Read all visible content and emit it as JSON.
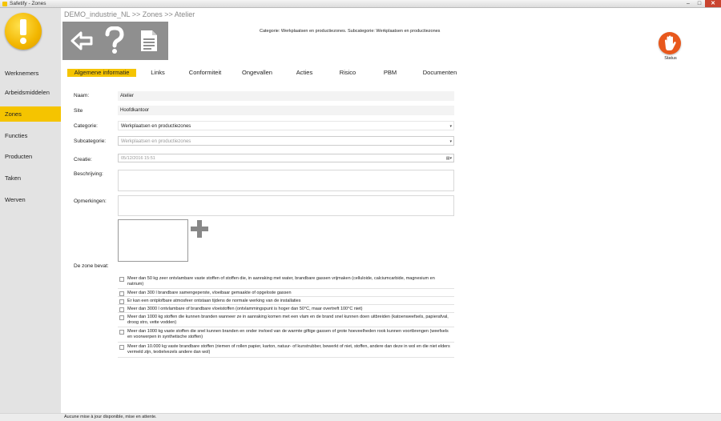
{
  "window": {
    "title": "Safetify - Zones",
    "minimize": "–",
    "maximize": "□",
    "close": "✕"
  },
  "breadcrumb": "DEMO_industrie_NL >> Zones >> Atelier",
  "category_info": "Categorie: Werkplaatsen en productiezones. Subcategorie: Werkplaatsen en productiezones",
  "status_label": "Status",
  "nav": [
    {
      "label": "Werknemers"
    },
    {
      "label": "Arbeidsmiddelen"
    },
    {
      "label": "Zones",
      "active": true
    },
    {
      "label": "Functies"
    },
    {
      "label": "Producten"
    },
    {
      "label": "Taken"
    },
    {
      "label": "Werven"
    }
  ],
  "tabs": [
    {
      "label": "Algemene informatie",
      "active": true
    },
    {
      "label": "Links"
    },
    {
      "label": "Conformiteit"
    },
    {
      "label": "Ongevallen"
    },
    {
      "label": "Acties"
    },
    {
      "label": "Risico"
    },
    {
      "label": "PBM"
    },
    {
      "label": "Documenten"
    }
  ],
  "form": {
    "naam_label": "Naam:",
    "naam_value": "Atelier",
    "site_label": "Site",
    "site_value": "Hoofdkantoor",
    "categorie_label": "Categorie:",
    "categorie_value": "Werkplaatsen en productiezones",
    "subcategorie_label": "Subcategorie:",
    "subcategorie_value": "Werkplaatsen en productiezones",
    "creatie_label": "Creatie:",
    "creatie_value": "05/12/2016 15:51",
    "beschrijving_label": "Beschrijving:",
    "opmerkingen_label": "Opmerkingen:",
    "zone_label": "De zone bevat:"
  },
  "checklist": [
    "Meer dan 50 kg zeer ontvlambare vaste stoffen of stoffen die, in aanraking met water, brandbare gassen vrijmaken (celluloide, calciumcarbide, magnesium en natrium)",
    "Meer dan 300 l brandbare samengeperste, vloeibaar gemaakte of opgeloste gassen",
    "Er kan een ontplofbare atmosfeer ontstaan tijdens de normale werking van de installaties",
    "Meer dan 3000 l ontvlambare of brandbare vloeistoffen (ontvlammingspunt is hoger dan 50°C, maar overtreft 100°C niet)",
    "Meer dan 1000 kg stoffen die kunnen branden wanneer ze in aanraking komen met een vlam en de brand snel kunnen doen uitbreiden (katoenweefsels, papierafval, droog stro, vette vodden)",
    "Meer dan 1000 kg vaste stoffen die snel kunnen branden en onder invloed van de warmte giftige gassen of grote hoeveelheden rook kunnen voortbrengen (weefsels en voorwerpen in synthetische stoffen)",
    "Meer dan 10.000 kg vaste brandbare stoffen (riemen of rollen papier, karton, natuur- of kunstrubber, bewerkt of niet, stoffen, andere dan deze in wol en die niet elders vermeld zijn, textielvezels andere dan wol)"
  ],
  "statusbar": "Aucune mise à jour disponible, mise en attente.",
  "colors": {
    "accent": "#f5c400",
    "sidebar": "#e3e3e3",
    "toolbar": "#8f8f8f",
    "status": "#e8581c"
  }
}
